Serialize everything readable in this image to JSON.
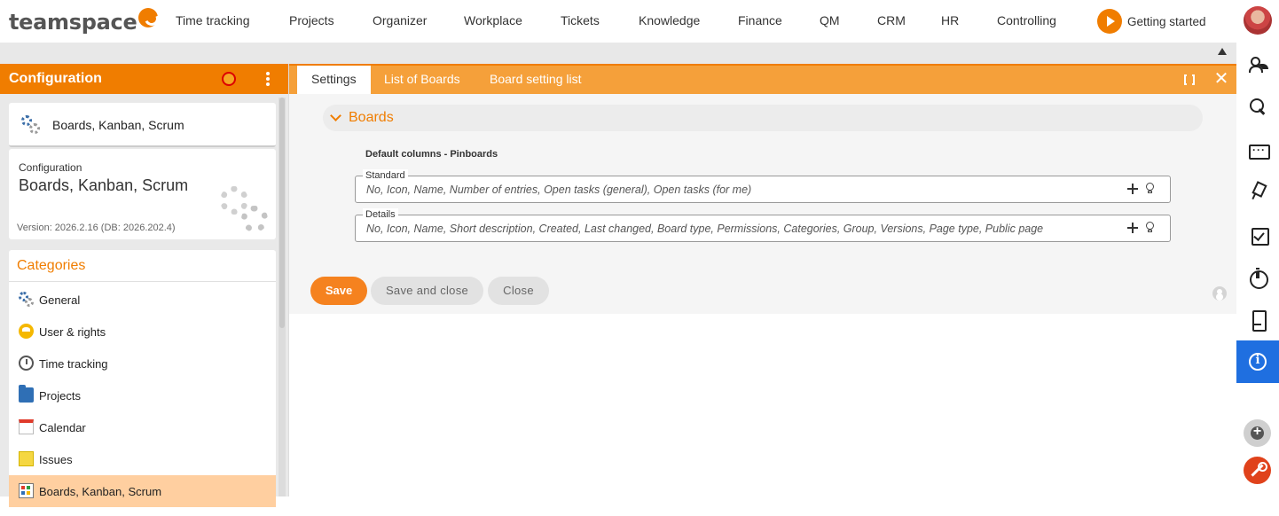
{
  "brand": {
    "logo_text": "teamspace"
  },
  "nav": {
    "items": [
      "Time tracking",
      "Projects",
      "Organizer",
      "Workplace",
      "Tickets",
      "Knowledge",
      "Finance",
      "QM",
      "CRM",
      "HR",
      "Controlling"
    ],
    "getting_started": "Getting started"
  },
  "left_panel": {
    "title": "Configuration",
    "selected_item": "Boards, Kanban, Scrum",
    "config_card": {
      "label": "Configuration",
      "name": "Boards, Kanban, Scrum",
      "version": "Version: 2026.2.16 (DB: 2026.202.4)"
    },
    "categories_title": "Categories",
    "categories": [
      {
        "label": "General",
        "icon": "gears-icon"
      },
      {
        "label": "User & rights",
        "icon": "user-rights-icon"
      },
      {
        "label": "Time tracking",
        "icon": "stopwatch-icon"
      },
      {
        "label": "Projects",
        "icon": "folder-icon"
      },
      {
        "label": "Calendar",
        "icon": "calendar-icon"
      },
      {
        "label": "Issues",
        "icon": "sticky-note-icon"
      },
      {
        "label": "Boards, Kanban, Scrum",
        "icon": "board-icon",
        "active": true
      }
    ]
  },
  "tabs": [
    {
      "label": "Settings",
      "active": true
    },
    {
      "label": "List of Boards"
    },
    {
      "label": "Board setting list"
    }
  ],
  "section": {
    "title": "Boards",
    "subheading": "Default columns - Pinboards",
    "fields": [
      {
        "legend": "Standard",
        "value": "No, Icon, Name, Number of entries, Open tasks (general), Open tasks (for me)"
      },
      {
        "legend": "Details",
        "value": "No, Icon, Name, Short description, Created, Last changed, Board type, Permissions, Categories, Group, Versions, Page type, Public page"
      }
    ]
  },
  "buttons": {
    "save": "Save",
    "save_and_close": "Save and close",
    "close": "Close"
  },
  "right_rail": {
    "icons": [
      "people-icon",
      "search-icon",
      "briefcase-icon",
      "pin-icon",
      "task-check-icon",
      "stopwatch-icon",
      "phone-icon",
      "info-icon"
    ],
    "active": "info-icon"
  },
  "colors": {
    "accent": "#f07d00",
    "tab_bar": "#f5a03a",
    "rail_active": "#1f6fe0",
    "tool_fab": "#e0421b"
  }
}
